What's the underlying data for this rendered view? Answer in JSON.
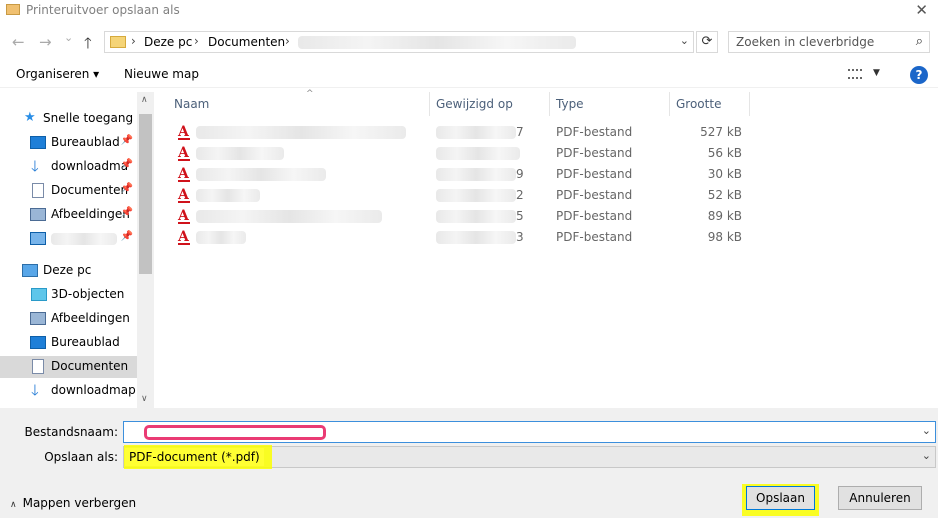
{
  "window": {
    "title": "Printeruitvoer opslaan als",
    "close_glyph": "✕",
    "app_icon": "mail-icon"
  },
  "nav": {
    "back_glyph": "←",
    "forward_glyph": "→",
    "recent_glyph": "⌄",
    "up_glyph": "🡑",
    "breadcrumb": [
      "Deze pc",
      "Documenten"
    ],
    "separator": "›",
    "refresh_glyph": "⟳",
    "dropdown_glyph": "⌄"
  },
  "search": {
    "placeholder": "Zoeken in cleverbridge",
    "icon_glyph": "⌕"
  },
  "toolbar": {
    "organize_label": "Organiseren ▾",
    "new_folder_label": "Nieuwe map",
    "view_dropdown_glyph": "▼",
    "help_glyph": "?"
  },
  "sidebar": {
    "pin_glyph": "📌",
    "up_arrow": "∧",
    "down_arrow": "∨",
    "items": [
      {
        "label": "Snelle toegang",
        "icon": "star-icon"
      },
      {
        "label": "Bureaublad",
        "icon": "desktop-icon"
      },
      {
        "label": "downloadma",
        "icon": "download-icon"
      },
      {
        "label": "Documenten",
        "icon": "document-icon"
      },
      {
        "label": "Afbeeldingen",
        "icon": "pictures-icon"
      },
      {
        "label": "Deze pc",
        "icon": "pc-icon"
      },
      {
        "label": "3D-objecten",
        "icon": "cube-icon"
      },
      {
        "label": "Afbeeldingen",
        "icon": "pictures-icon"
      },
      {
        "label": "Bureaublad",
        "icon": "desktop-icon"
      },
      {
        "label": "Documenten",
        "icon": "document-icon"
      },
      {
        "label": "downloadmap",
        "icon": "download-icon"
      }
    ],
    "selected": "Documenten"
  },
  "filelist": {
    "columns": [
      "Naam",
      "Gewijzigd op",
      "Type",
      "Grootte"
    ],
    "sort_glyph": "^",
    "rows": [
      {
        "type": "PDF-bestand",
        "size": "527 kB",
        "date_tail": "7"
      },
      {
        "type": "PDF-bestand",
        "size": "56 kB",
        "date_tail": ""
      },
      {
        "type": "PDF-bestand",
        "size": "30 kB",
        "date_tail": "9"
      },
      {
        "type": "PDF-bestand",
        "size": "52 kB",
        "date_tail": "2"
      },
      {
        "type": "PDF-bestand",
        "size": "89 kB",
        "date_tail": "5"
      },
      {
        "type": "PDF-bestand",
        "size": "98 kB",
        "date_tail": "3"
      }
    ],
    "pdf_glyph": "A"
  },
  "form": {
    "filename_label": "Bestandsnaam:",
    "filename_value": "",
    "savetype_label": "Opslaan als:",
    "savetype_value": "PDF-document (*.pdf)",
    "dropdown_glyph": "⌄"
  },
  "footer": {
    "hide_folders_label": "Mappen verbergen",
    "hide_folders_glyph": "∧",
    "save_label": "Opslaan",
    "cancel_label": "Annuleren"
  },
  "colors": {
    "highlight_yellow": "#fbff00",
    "annotation_pink": "#ea3b74",
    "pdf_red": "#d0121b",
    "help_blue": "#1b66c9"
  }
}
